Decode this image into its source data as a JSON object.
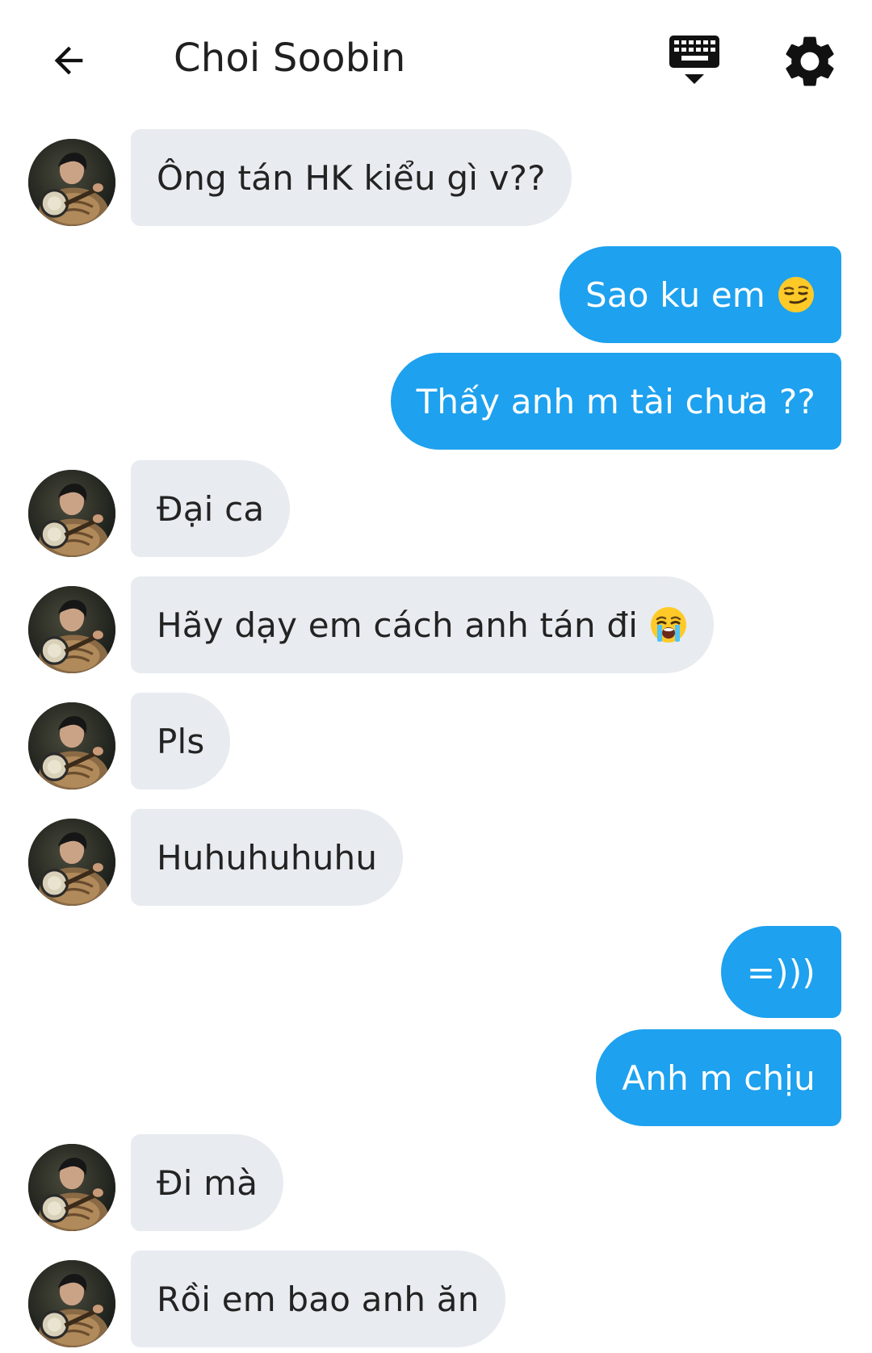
{
  "header": {
    "title": "Choi Soobin",
    "back_icon": "arrow-left-icon",
    "keyboard_icon": "keyboard-hide-icon",
    "settings_icon": "gear-icon"
  },
  "colors": {
    "outgoing_bubble": "#1ea1ee",
    "incoming_bubble": "#e8ebef",
    "outgoing_text": "#ffffff",
    "incoming_text": "#232323"
  },
  "messages": [
    {
      "sender": "contact",
      "text": "Ông tán HK kiểu gì v??"
    },
    {
      "sender": "me",
      "text": "Sao ku em",
      "emoji": "smirking-face-emoji"
    },
    {
      "sender": "me",
      "text": "Thấy anh m tài chưa ??"
    },
    {
      "sender": "contact",
      "text": "Đại ca"
    },
    {
      "sender": "contact",
      "text": "Hãy dạy em cách anh tán đi",
      "emoji": "loudly-crying-face-emoji"
    },
    {
      "sender": "contact",
      "text": "Pls"
    },
    {
      "sender": "contact",
      "text": "Huhuhuhuhu"
    },
    {
      "sender": "me",
      "text": "=)))"
    },
    {
      "sender": "me",
      "text": "Anh m chịu"
    },
    {
      "sender": "contact",
      "text": "Đi mà"
    },
    {
      "sender": "contact",
      "text": "Rồi em bao anh ăn"
    }
  ]
}
